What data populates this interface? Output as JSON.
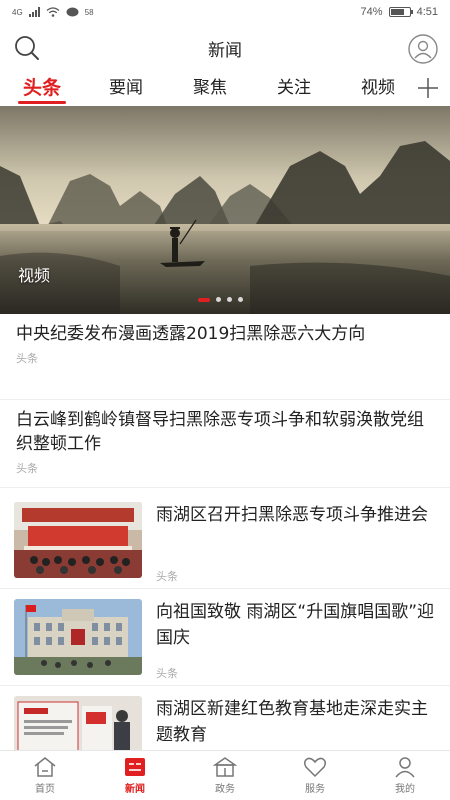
{
  "status_bar": {
    "network": "4G",
    "notify_count": "58",
    "battery": "74%",
    "battery_level": 0.74,
    "time": "4:51"
  },
  "header": {
    "title": "新闻"
  },
  "tabs": [
    "头条",
    "要闻",
    "聚焦",
    "关注",
    "视频"
  ],
  "hero": {
    "label": "视频",
    "slide_count": 4,
    "active_slide": 1
  },
  "feed": {
    "text_items": [
      {
        "headline": "中央纪委发布漫画透露2019扫黑除恶六大方向",
        "source": "头条"
      },
      {
        "headline": "白云峰到鹤岭镇督导扫黑除恶专项斗争和软弱涣散党组织整顿工作",
        "source": "头条"
      }
    ],
    "image_items": [
      {
        "headline": "雨湖区召开扫黑除恶专项斗争推进会",
        "source": "头条"
      },
      {
        "headline": "向祖国致敬 雨湖区“升国旗唱国歌”迎国庆",
        "source": "头条"
      },
      {
        "headline": "雨湖区新建红色教育基地走深走实主题教育",
        "source": ""
      }
    ]
  },
  "bottom_nav": [
    "首页",
    "新闻",
    "政务",
    "服务",
    "我的"
  ],
  "colors": {
    "accent": "#e02020"
  }
}
